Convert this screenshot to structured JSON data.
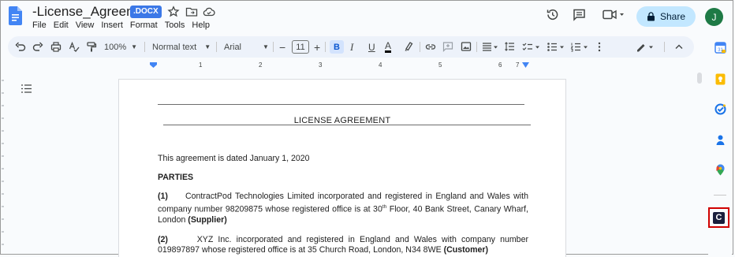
{
  "header": {
    "doc_title": "-License_Agreement",
    "file_badge": ".DOCX",
    "share_label": "Share",
    "avatar_letter": "J"
  },
  "menu": [
    "File",
    "Edit",
    "View",
    "Insert",
    "Format",
    "Tools",
    "Help"
  ],
  "toolbar": {
    "zoom": "100%",
    "style": "Normal text",
    "font": "Arial",
    "font_size": "11",
    "bold": "B",
    "italic": "I",
    "underline": "U",
    "text_color": "A"
  },
  "ruler": [
    "1",
    "2",
    "3",
    "4",
    "5",
    "6",
    "7"
  ],
  "document": {
    "title": "LICENSE AGREEMENT",
    "date_line": "This agreement is dated January 1, 2020",
    "parties_heading": "PARTIES",
    "party1_num": "(1)",
    "party1_text_a": "ContractPod Technologies Limited incorporated and registered in England and Wales with company number 98209875 whose registered office is at 30",
    "party1_sup": "th",
    "party1_text_b": " Floor, 40 Bank Street, Canary Wharf, London ",
    "party1_role": "(Supplier)",
    "party2_num": "(2)",
    "party2_text": "XYZ Inc. incorporated and registered in England and Wales with company number 019897897 whose registered office is at 35 Church Road, London, N34 8WE ",
    "party2_role": "(Customer)"
  },
  "addon": {
    "letter": "C"
  },
  "colors": {
    "accent": "#0b57d0",
    "share_bg": "#c2e7ff",
    "avatar_bg": "#1e7a46",
    "badge_bg": "#3b78e7",
    "highlight_border": "#d00000"
  }
}
